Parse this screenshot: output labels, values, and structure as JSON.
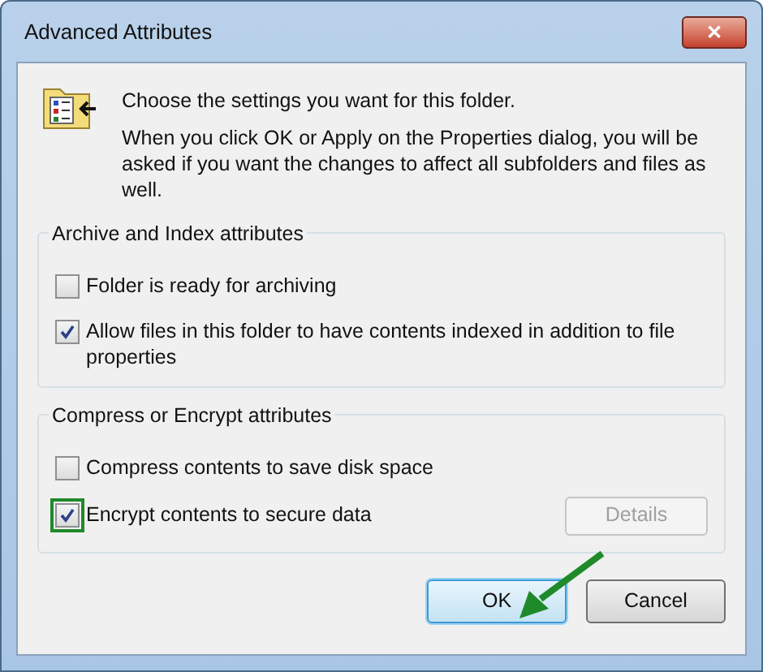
{
  "window": {
    "title": "Advanced Attributes",
    "close": "✕"
  },
  "intro": {
    "heading": "Choose the settings you want for this folder.",
    "body": "When you click OK or Apply on the Properties dialog, you will be asked if you want the changes to affect all subfolders and files as well."
  },
  "groups": [
    {
      "title": "Archive and Index attributes",
      "options": [
        {
          "label": "Folder is ready for archiving",
          "checked": false,
          "highlighted": false
        },
        {
          "label": "Allow files in this folder to have contents indexed in addition to file properties",
          "checked": true,
          "highlighted": false
        }
      ]
    },
    {
      "title": "Compress or Encrypt attributes",
      "options": [
        {
          "label": "Compress contents to save disk space",
          "checked": false,
          "highlighted": false
        },
        {
          "label": "Encrypt contents to secure data",
          "checked": true,
          "highlighted": true
        }
      ],
      "button": {
        "label": "Details",
        "disabled": true
      }
    }
  ],
  "buttons": [
    {
      "label": "OK",
      "default": true
    },
    {
      "label": "Cancel",
      "default": false
    }
  ]
}
